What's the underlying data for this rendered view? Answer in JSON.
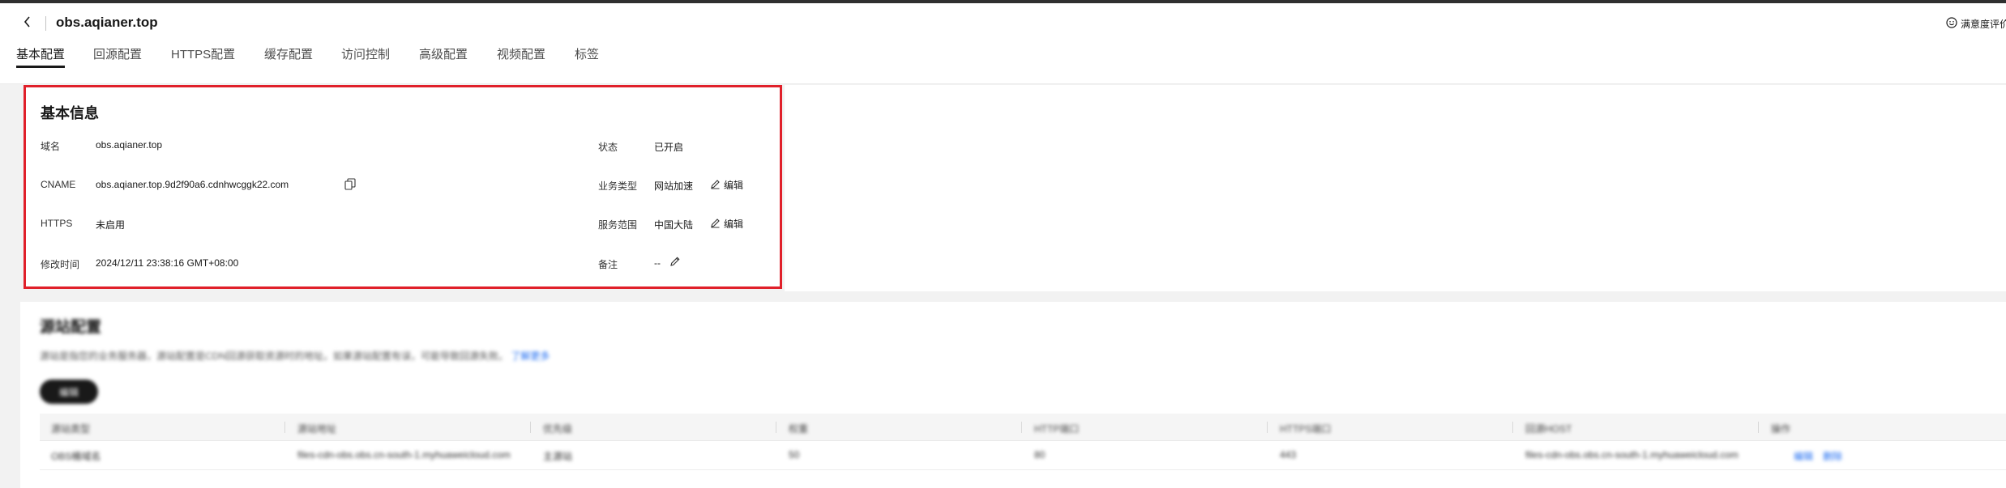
{
  "header": {
    "title": "obs.aqianer.top",
    "feedback_label": "满意度评价",
    "tabs": [
      {
        "label": "基本配置"
      },
      {
        "label": "回源配置"
      },
      {
        "label": "HTTPS配置"
      },
      {
        "label": "缓存配置"
      },
      {
        "label": "访问控制"
      },
      {
        "label": "高级配置"
      },
      {
        "label": "视频配置"
      },
      {
        "label": "标签"
      }
    ]
  },
  "basic_info": {
    "title": "基本信息",
    "domain_label": "域名",
    "domain_value": "obs.aqianer.top",
    "cname_label": "CNAME",
    "cname_value": "obs.aqianer.top.9d2f90a6.cdnhwcggk22.com",
    "https_label": "HTTPS",
    "https_value": "未启用",
    "modified_label": "修改时间",
    "modified_value": "2024/12/11 23:38:16 GMT+08:00",
    "status_label": "状态",
    "status_value": "已开启",
    "business_label": "业务类型",
    "business_value": "网站加速",
    "scope_label": "服务范围",
    "scope_value": "中国大陆",
    "remark_label": "备注",
    "remark_value": "--",
    "edit_label": "编辑"
  },
  "origin_section": {
    "title": "源站配置",
    "description": "源站是指您的业务服务器，源站配置是CDN回源获取资源时的地址。如果源站配置有误，可能导致回源失败。",
    "description_link": "了解更多",
    "edit_button": "编辑",
    "columns": [
      "源站类型",
      "源站地址",
      "优先级",
      "权重",
      "HTTP端口",
      "HTTPS端口",
      "回源HOST",
      "操作"
    ],
    "rows": [
      {
        "cells": [
          "OBS桶域名",
          "files-cdn-obs.obs.cn-south-1.myhuaweicloud.com",
          "主源站",
          "50",
          "80",
          "443",
          "files-cdn-obs.obs.cn-south-1.myhuaweicloud.com",
          ""
        ],
        "actions": [
          "编辑",
          "删除"
        ]
      }
    ]
  },
  "colors": {
    "highlight_border": "#e0202a",
    "link": "#1e6cf1",
    "text_primary": "#191919"
  }
}
